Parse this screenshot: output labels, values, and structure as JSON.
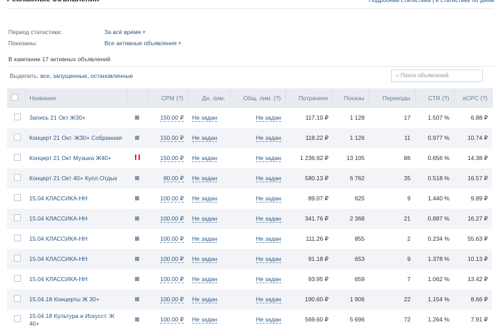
{
  "header": {
    "title": "Рекламные объявления",
    "links": "Подробная статистика | К статистике по дням"
  },
  "filters": {
    "period_label": "Период статистики:",
    "period_value": "За всё время",
    "shown_label": "Показаны:",
    "shown_value": "Все активные объявления"
  },
  "count": "В кампании 17 активных объявлений",
  "select": {
    "label": "Выделить:",
    "options": "все, запущенные, остановленные"
  },
  "search": {
    "placeholder": "⌕ Поиск объявлений"
  },
  "columns": [
    "Название",
    "",
    "CPM (?)",
    "Дн. лим.",
    "Общ. лим. (?)",
    "Потрачено",
    "Показы",
    "Переходы",
    "CTR (?)",
    "eCPC (?)"
  ],
  "rows": [
    {
      "name": "Запись 21 Окт Ж30+",
      "status": "running",
      "cpm": "150.00 ₽",
      "day": "Не задан",
      "total": "Не задан",
      "spent": "117.10 ₽",
      "shows": "1 128",
      "clicks": "17",
      "ctr": "1.507 %",
      "ecpc": "6.88 ₽"
    },
    {
      "name": "Концерт 21 Окт. Ж30+ Собранная",
      "status": "running",
      "cpm": "150.00 ₽",
      "day": "Не задан",
      "total": "Не задан",
      "spent": "118.22 ₽",
      "shows": "1 126",
      "clicks": "11",
      "ctr": "0.977 %",
      "ecpc": "10.74 ₽"
    },
    {
      "name": "Концерт 21 Окт Музыка Ж40+",
      "status": "paused",
      "cpm": "150.00 ₽",
      "day": "Не задан",
      "total": "Не задан",
      "spent": "1 236.92 ₽",
      "shows": "13 105",
      "clicks": "86",
      "ctr": "0.656 %",
      "ecpc": "14.38 ₽"
    },
    {
      "name": "Концерт 21 Окт 40+ Купл.Отдых",
      "status": "running",
      "cpm": "80.00 ₽",
      "day": "Не задан",
      "total": "Не задан",
      "spent": "580.13 ₽",
      "shows": "6 762",
      "clicks": "35",
      "ctr": "0.518 %",
      "ecpc": "16.57 ₽"
    },
    {
      "name": "15.04 КЛАССИКА-НН",
      "status": "running",
      "cpm": "100.00 ₽",
      "day": "Не задан",
      "total": "Не задан",
      "spent": "89.07 ₽",
      "shows": "625",
      "clicks": "9",
      "ctr": "1.440 %",
      "ecpc": "9.89 ₽"
    },
    {
      "name": "15.04 КЛАССИКА-НН",
      "status": "running",
      "cpm": "100.00 ₽",
      "day": "Не задан",
      "total": "Не задан",
      "spent": "341.76 ₽",
      "shows": "2 368",
      "clicks": "21",
      "ctr": "0.887 %",
      "ecpc": "16.27 ₽"
    },
    {
      "name": "15.04 КЛАССИКА-НН",
      "status": "running",
      "cpm": "100.00 ₽",
      "day": "Не задан",
      "total": "Не задан",
      "spent": "111.26 ₽",
      "shows": "855",
      "clicks": "2",
      "ctr": "0.234 %",
      "ecpc": "55.63 ₽"
    },
    {
      "name": "15.04 КЛАССИКА-НН",
      "status": "running",
      "cpm": "100.00 ₽",
      "day": "Не задан",
      "total": "Не задан",
      "spent": "91.18 ₽",
      "shows": "653",
      "clicks": "9",
      "ctr": "1.378 %",
      "ecpc": "10.13 ₽"
    },
    {
      "name": "15.04 КЛАССИКА-НН",
      "status": "running",
      "cpm": "100.00 ₽",
      "day": "Не задан",
      "total": "Не задан",
      "spent": "93.95 ₽",
      "shows": "659",
      "clicks": "7",
      "ctr": "1.062 %",
      "ecpc": "13.42 ₽"
    },
    {
      "name": "15.04.18 Концерты Ж 30+",
      "status": "running",
      "cpm": "100.00 ₽",
      "day": "Не задан",
      "total": "Не задан",
      "spent": "190.60 ₽",
      "shows": "1 906",
      "clicks": "22",
      "ctr": "1.154 %",
      "ecpc": "8.66 ₽"
    },
    {
      "name": "15.04.18 Культура и Искусст. Ж 40+",
      "status": "running",
      "cpm": "100.00 ₽",
      "day": "Не задан",
      "total": "Не задан",
      "spent": "569.60 ₽",
      "shows": "5 696",
      "clicks": "72",
      "ctr": "1.264 %",
      "ecpc": "7.91 ₽"
    }
  ]
}
